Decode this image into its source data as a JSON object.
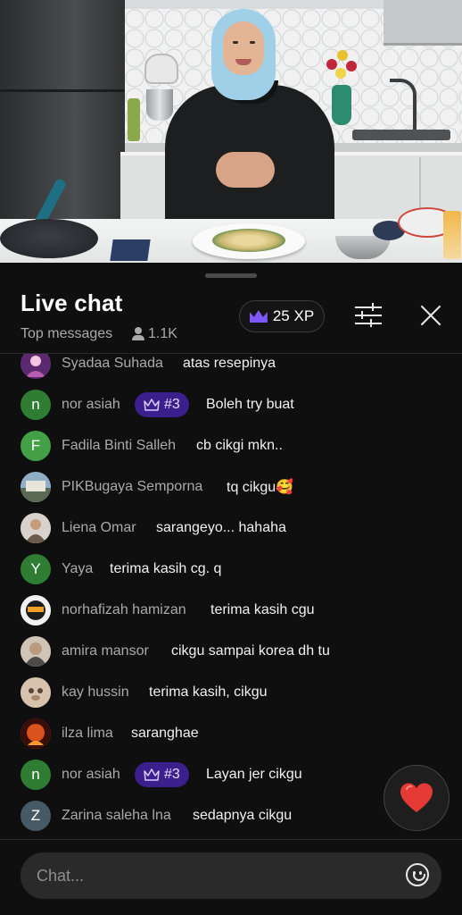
{
  "video": {
    "description_icon": "video-frame"
  },
  "header": {
    "title": "Live chat",
    "subtitle": "Top messages",
    "viewer_count": "1.1K",
    "xp_label": "25 XP"
  },
  "messages": [
    {
      "name": "Syadaa Suhada",
      "text": "atas resepinya",
      "avatar_color": "#5b2a6e",
      "avatar_letter": "",
      "badge": ""
    },
    {
      "name": "nor asiah",
      "text": "Boleh try buat",
      "avatar_color": "#2e7d32",
      "avatar_letter": "n",
      "badge": "#3"
    },
    {
      "name": "Fadila Binti Salleh",
      "text": "cb cikgi mkn..",
      "avatar_color": "#43a047",
      "avatar_letter": "F",
      "badge": ""
    },
    {
      "name": "PIKBugaya Semporna",
      "text": "tq cikgu🥰",
      "avatar_color": "#6d7f8a",
      "avatar_letter": "",
      "badge": ""
    },
    {
      "name": "Liena Omar",
      "text": "sarangeyo... hahaha",
      "avatar_color": "#8a7a6e",
      "avatar_letter": "",
      "badge": ""
    },
    {
      "name": "Yaya",
      "text": "terima kasih cg. q",
      "avatar_color": "#2e7d32",
      "avatar_letter": "Y",
      "badge": ""
    },
    {
      "name": "norhafizah hamizan",
      "text": "terima kasih cgu",
      "avatar_color": "#f2f2f2",
      "avatar_letter": "",
      "badge": ""
    },
    {
      "name": "amira mansor",
      "text": "cikgu sampai korea dh tu",
      "avatar_color": "#9c8b7a",
      "avatar_letter": "",
      "badge": ""
    },
    {
      "name": "kay hussin",
      "text": "terima kasih, cikgu",
      "avatar_color": "#c9b29a",
      "avatar_letter": "",
      "badge": ""
    },
    {
      "name": "ilza lima",
      "text": "saranghae",
      "avatar_color": "#b3401f",
      "avatar_letter": "",
      "badge": ""
    },
    {
      "name": "nor asiah",
      "text": "Layan jer cikgu",
      "avatar_color": "#2e7d32",
      "avatar_letter": "n",
      "badge": "#3"
    },
    {
      "name": "Zarina saleha lna",
      "text": "sedapnya cikgu",
      "avatar_color": "#455a64",
      "avatar_letter": "Z",
      "badge": ""
    }
  ],
  "input": {
    "placeholder": "Chat..."
  },
  "colors": {
    "panel_bg": "#0f0f0f",
    "badge_bg": "#3c1e8c",
    "accent_purple": "#7e57ff",
    "heart_red": "#e53935"
  }
}
